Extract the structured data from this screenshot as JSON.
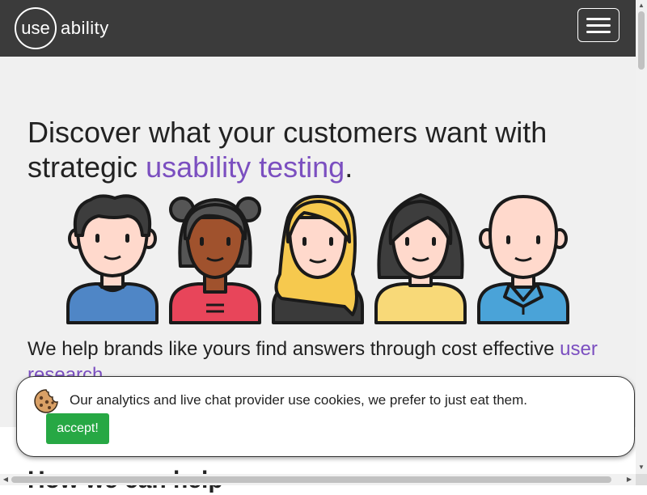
{
  "navbar": {
    "logo_part1": "use",
    "logo_part2": "ability",
    "menu_icon": "hamburger-icon",
    "bg_color": "#3b3b3b"
  },
  "hero": {
    "headline_before": "Discover what your customers want with strategic ",
    "headline_accent": "usability testing",
    "headline_after": ".",
    "subtext_before": "We help brands like yours find answers through cost effective ",
    "subtext_accent": "user research",
    "subtext_after": ".",
    "accent_color": "#7b4fc0",
    "avatars": [
      "man-dark-hair-avatar",
      "woman-buns-avatar",
      "woman-blonde-avatar",
      "woman-black-hair-avatar",
      "bald-man-avatar"
    ]
  },
  "next_section": {
    "heading_partial": "How we can help"
  },
  "cookie_banner": {
    "icon": "cookie-icon",
    "text": "Our analytics and live chat provider use cookies, we prefer to just eat them.",
    "accept_label": "accept!",
    "accept_color": "#27a844"
  },
  "scrollbars": {
    "up_arrow": "▲",
    "down_arrow": "▼",
    "left_arrow": "◀",
    "right_arrow": "▶"
  }
}
